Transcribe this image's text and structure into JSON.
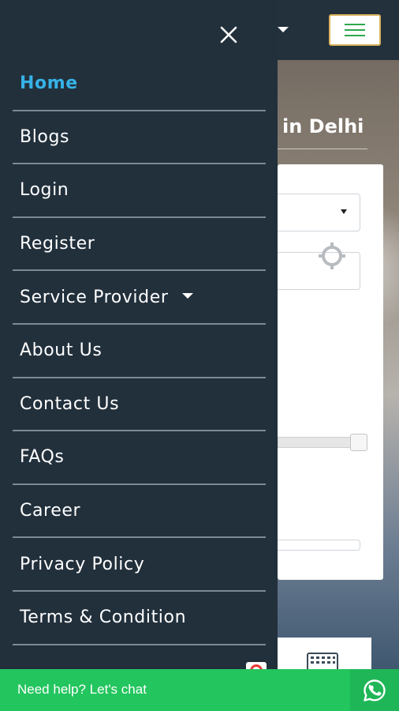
{
  "background": {
    "hero_title": "in Delhi"
  },
  "drawer": {
    "close_icon": "close-icon",
    "items": [
      {
        "label": "Home",
        "active": true
      },
      {
        "label": "Blogs",
        "active": false
      },
      {
        "label": "Login",
        "active": false
      },
      {
        "label": "Register",
        "active": false
      },
      {
        "label": "Service Provider",
        "active": false,
        "has_dropdown": true
      },
      {
        "label": "About Us",
        "active": false
      },
      {
        "label": "Contact Us",
        "active": false
      },
      {
        "label": "FAQs",
        "active": false
      },
      {
        "label": "Career",
        "active": false
      },
      {
        "label": "Privacy Policy",
        "active": false
      },
      {
        "label": "Terms & Condition",
        "active": false
      }
    ]
  },
  "chat": {
    "label": "Need help? Let's chat",
    "icon": "whatsapp-icon"
  },
  "colors": {
    "drawer_bg": "#22303c",
    "active_link": "#36b2e6",
    "divider": "#7d8a96",
    "chat_bar": "#23c55e",
    "hamburger_border": "#d9b35d",
    "hamburger_lines": "#2fa84f"
  }
}
